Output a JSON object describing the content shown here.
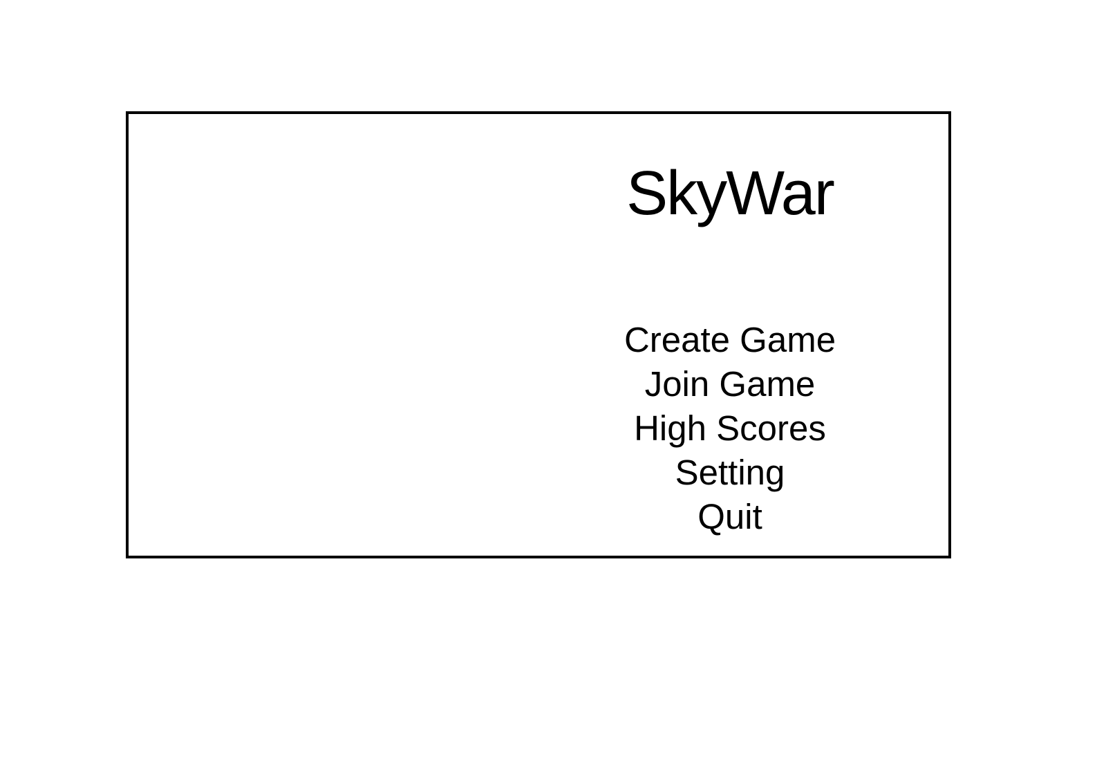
{
  "game": {
    "title": "SkyWar"
  },
  "menu": {
    "items": [
      {
        "label": "Create Game"
      },
      {
        "label": "Join Game"
      },
      {
        "label": "High Scores"
      },
      {
        "label": "Setting"
      },
      {
        "label": "Quit"
      }
    ]
  },
  "colors": {
    "background": "#ffffff",
    "border": "#000000",
    "text": "#000000"
  }
}
